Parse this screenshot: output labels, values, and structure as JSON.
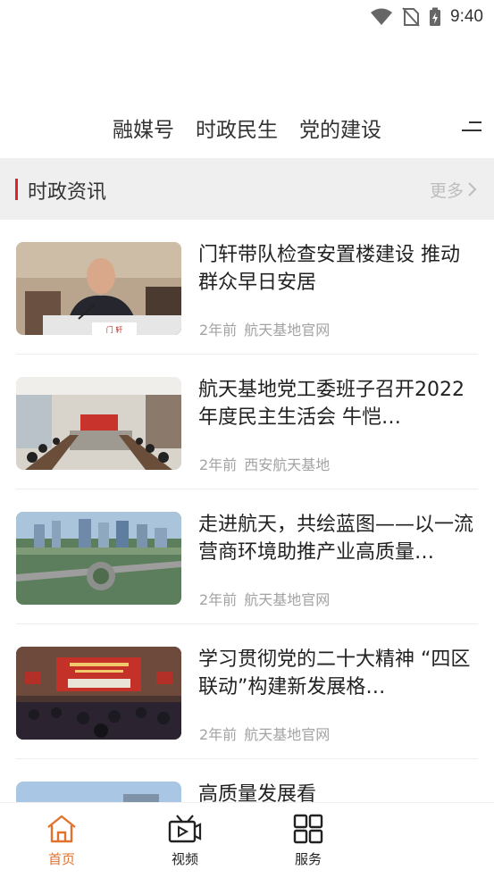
{
  "status_bar": {
    "time": "9:40"
  },
  "channel_tabs": {
    "items": [
      {
        "label": "融媒号"
      },
      {
        "label": "时政民生"
      },
      {
        "label": "党的建设"
      }
    ]
  },
  "section": {
    "title": "时政资讯",
    "more_label": "更多"
  },
  "news": [
    {
      "title": "门轩带队检查安置楼建设 推动群众早日安居",
      "time": "2年前",
      "source": "航天基地官网"
    },
    {
      "title": "航天基地党工委班子召开2022年度民主生活会 牛恺…",
      "time": "2年前",
      "source": "西安航天基地"
    },
    {
      "title": "走进航天，共绘蓝图——以一流营商环境助推产业高质量…",
      "time": "2年前",
      "source": "航天基地官网"
    },
    {
      "title": "学习贯彻党的二十大精神 “四区联动”构建新发展格…",
      "time": "2年前",
      "source": "航天基地官网"
    },
    {
      "title": "高质量发展看",
      "time": "",
      "source": ""
    }
  ],
  "bottom_nav": {
    "items": [
      {
        "label": "首页",
        "icon": "home-icon"
      },
      {
        "label": "视频",
        "icon": "video-icon"
      },
      {
        "label": "服务",
        "icon": "grid-icon"
      }
    ]
  },
  "colors": {
    "accent": "#d8262c",
    "active_nav": "#e0722e",
    "meta_text": "#a3a3a3",
    "section_bg": "#efefef"
  }
}
